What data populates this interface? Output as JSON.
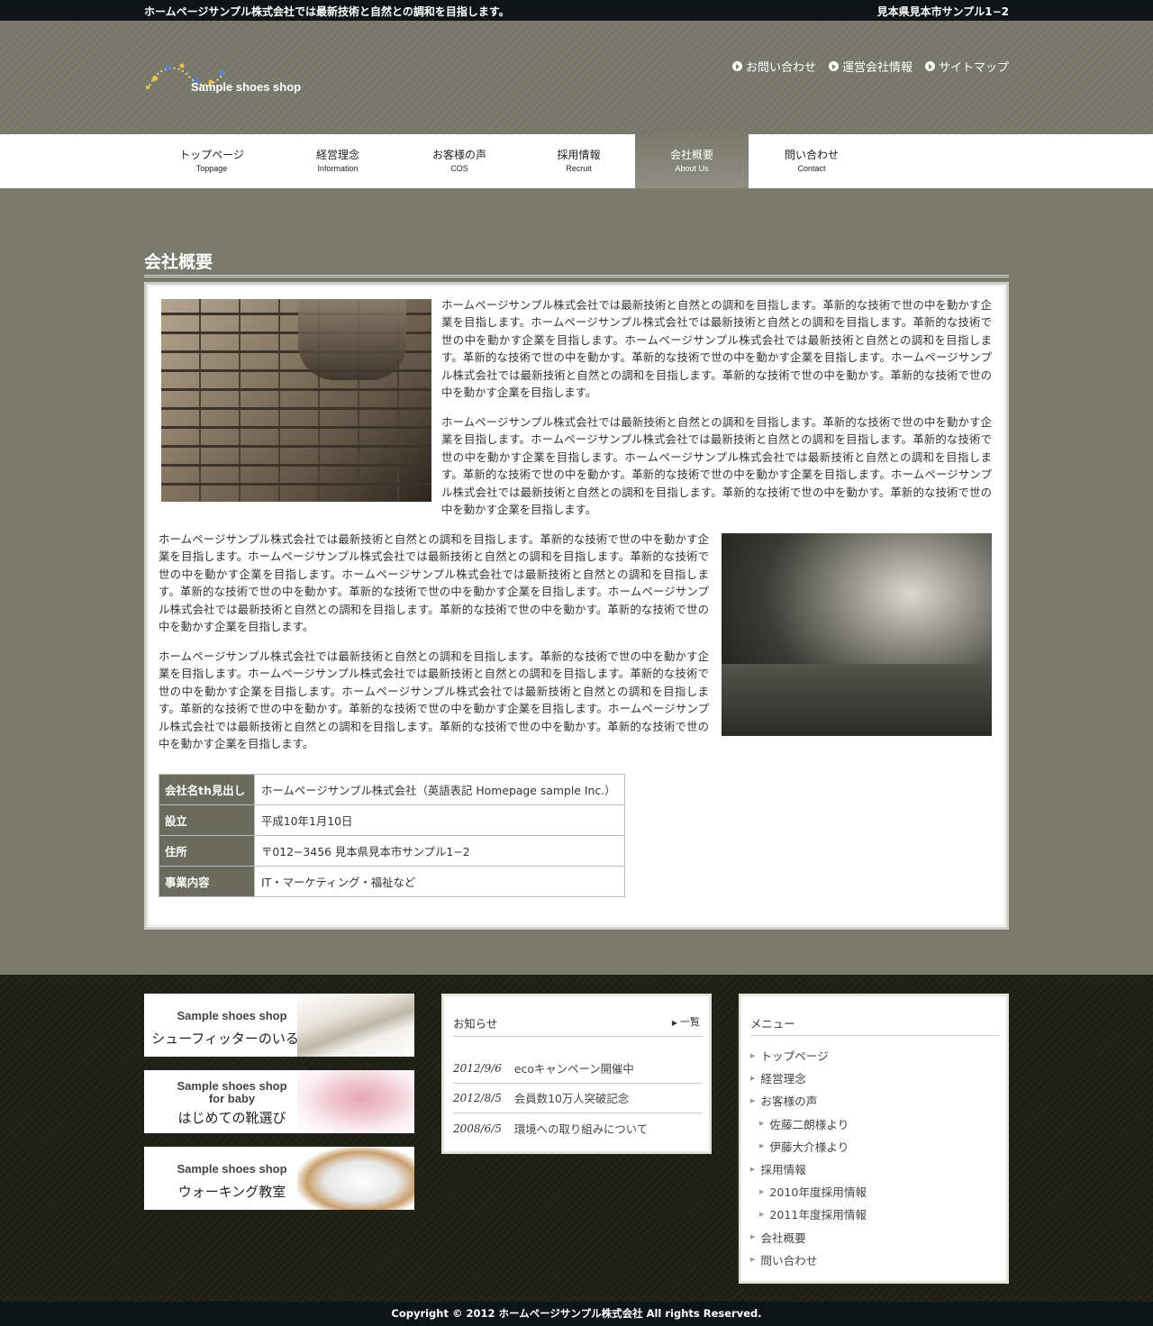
{
  "topbar": {
    "tagline": "ホームページサンプル株式会社では最新技術と自然との調和を目指します。",
    "address": "見本県見本市サンプル1−2"
  },
  "header": {
    "logo_text": "Sample shoes shop",
    "util_links": [
      "お問い合わせ",
      "運営会社情報",
      "サイトマップ"
    ]
  },
  "nav": {
    "items": [
      {
        "jp": "トップページ",
        "en": "Toppage"
      },
      {
        "jp": "経営理念",
        "en": "Information"
      },
      {
        "jp": "お客様の声",
        "en": "COS"
      },
      {
        "jp": "採用情報",
        "en": "Recruit"
      },
      {
        "jp": "会社概要",
        "en": "About Us"
      },
      {
        "jp": "問い合わせ",
        "en": "Contact"
      }
    ],
    "active_index": 4
  },
  "main": {
    "title": "会社概要",
    "paragraphs": [
      "ホームページサンプル株式会社では最新技術と自然との調和を目指します。革新的な技術で世の中を動かす企業を目指します。ホームページサンプル株式会社では最新技術と自然との調和を目指します。革新的な技術で世の中を動かす企業を目指します。ホームページサンプル株式会社では最新技術と自然との調和を目指します。革新的な技術で世の中を動かす。革新的な技術で世の中を動かす企業を目指します。ホームページサンプル株式会社では最新技術と自然との調和を目指します。革新的な技術で世の中を動かす。革新的な技術で世の中を動かす企業を目指します。",
      "ホームページサンプル株式会社では最新技術と自然との調和を目指します。革新的な技術で世の中を動かす企業を目指します。ホームページサンプル株式会社では最新技術と自然との調和を目指します。革新的な技術で世の中を動かす企業を目指します。ホームページサンプル株式会社では最新技術と自然との調和を目指します。革新的な技術で世の中を動かす。革新的な技術で世の中を動かす企業を目指します。ホームページサンプル株式会社では最新技術と自然との調和を目指します。革新的な技術で世の中を動かす。革新的な技術で世の中を動かす企業を目指します。",
      "ホームページサンプル株式会社では最新技術と自然との調和を目指します。革新的な技術で世の中を動かす企業を目指します。ホームページサンプル株式会社では最新技術と自然との調和を目指します。革新的な技術で世の中を動かす企業を目指します。ホームページサンプル株式会社では最新技術と自然との調和を目指します。革新的な技術で世の中を動かす。革新的な技術で世の中を動かす企業を目指します。ホームページサンプル株式会社では最新技術と自然との調和を目指します。革新的な技術で世の中を動かす。革新的な技術で世の中を動かす企業を目指します。",
      "ホームページサンプル株式会社では最新技術と自然との調和を目指します。革新的な技術で世の中を動かす企業を目指します。ホームページサンプル株式会社では最新技術と自然との調和を目指します。革新的な技術で世の中を動かす企業を目指します。ホームページサンプル株式会社では最新技術と自然との調和を目指します。革新的な技術で世の中を動かす。革新的な技術で世の中を動かす企業を目指します。ホームページサンプル株式会社では最新技術と自然との調和を目指します。革新的な技術で世の中を動かす。革新的な技術で世の中を動かす企業を目指します。"
    ],
    "table": [
      {
        "th": "会社名th見出し",
        "td": "ホームページサンプル株式会社（英語表記 Homepage sample Inc.）"
      },
      {
        "th": "設立",
        "td": "平成10年1月10日"
      },
      {
        "th": "住所",
        "td": "〒012−3456 見本県見本市サンプル1−2"
      },
      {
        "th": "事業内容",
        "td": "IT・マーケティング・福祉など"
      }
    ]
  },
  "banners": [
    {
      "en": "Sample shoes shop",
      "jp": "シューフィッターのいる店"
    },
    {
      "en": "Sample shoes shop",
      "en2": "for baby",
      "jp": "はじめての靴選び"
    },
    {
      "en": "Sample shoes shop",
      "jp": "ウォーキング教室"
    }
  ],
  "news": {
    "title": "お知らせ",
    "all_label": "一覧",
    "items": [
      {
        "date": "2012/9/6",
        "text": "ecoキャンペーン開催中"
      },
      {
        "date": "2012/8/5",
        "text": "会員数10万人突破記念"
      },
      {
        "date": "2008/6/5",
        "text": "環境への取り組みについて"
      }
    ]
  },
  "menu": {
    "title": "メニュー",
    "items": [
      {
        "label": "トップページ",
        "sub": false
      },
      {
        "label": "経営理念",
        "sub": false
      },
      {
        "label": "お客様の声",
        "sub": false
      },
      {
        "label": "佐藤二朗様より",
        "sub": true
      },
      {
        "label": "伊藤大介様より",
        "sub": true
      },
      {
        "label": "採用情報",
        "sub": false
      },
      {
        "label": "2010年度採用情報",
        "sub": true
      },
      {
        "label": "2011年度採用情報",
        "sub": true
      },
      {
        "label": "会社概要",
        "sub": false
      },
      {
        "label": "問い合わせ",
        "sub": false
      }
    ]
  },
  "footer": {
    "copyright": "Copyright © 2012 ホームページサンプル株式会社 All rights Reserved."
  }
}
